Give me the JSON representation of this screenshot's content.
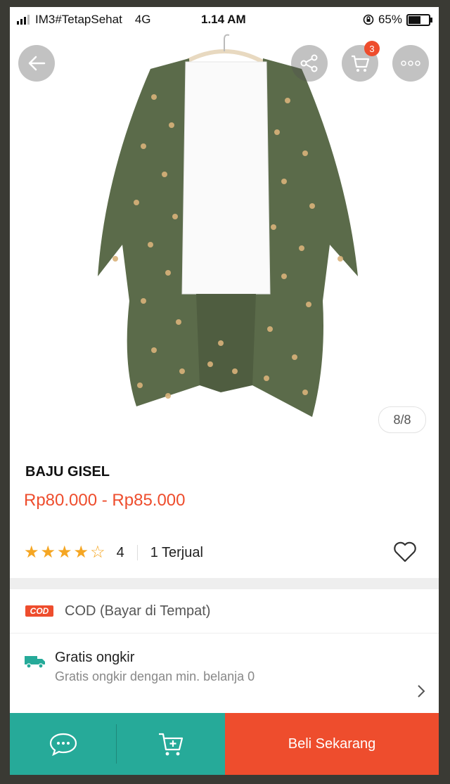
{
  "status_bar": {
    "carrier": "IM3#TetapSehat",
    "network": "4G",
    "time": "1.14 AM",
    "battery": "65%",
    "battery_level": 0.65
  },
  "gallery": {
    "counter": "8/8",
    "cart_count": "3"
  },
  "product": {
    "name": "BAJU GISEL",
    "price_range": "Rp80.000 - Rp85.000",
    "rating": "4",
    "rating_stars": 4,
    "sold": "1 Terjual"
  },
  "cod": {
    "badge": "COD",
    "label": "COD (Bayar di Tempat)"
  },
  "shipping": {
    "title": "Gratis ongkir",
    "subtitle": "Gratis ongkir dengan min. belanja 0"
  },
  "bottom_bar": {
    "buy_label": "Beli Sekarang"
  },
  "colors": {
    "accent": "#ee4d2d",
    "teal": "#26aa99",
    "star": "#f5a623"
  }
}
